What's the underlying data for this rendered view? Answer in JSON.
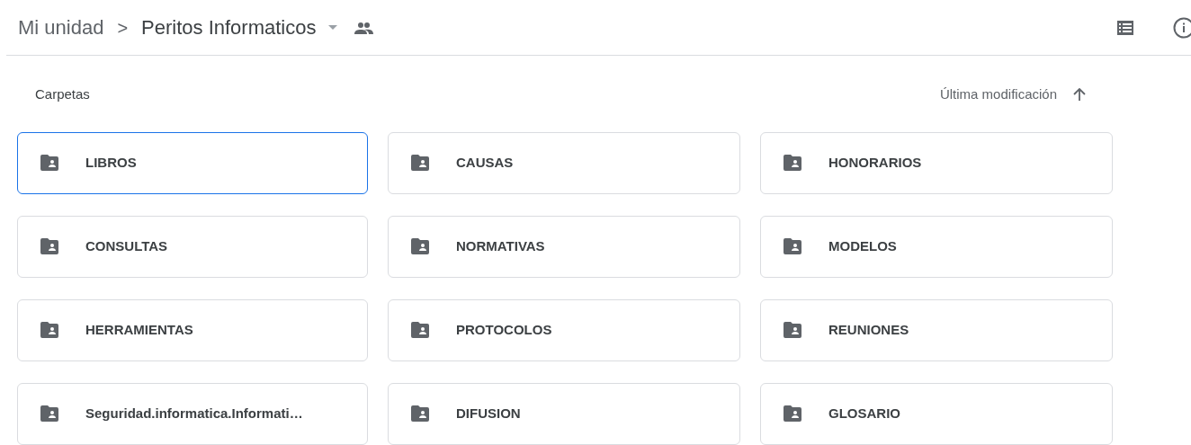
{
  "breadcrumb": {
    "root": "Mi unidad",
    "separator": ">",
    "current": "Peritos Informaticos"
  },
  "section": {
    "title": "Carpetas",
    "sort_label": "Última modificación"
  },
  "folders": [
    {
      "name": "LIBROS",
      "selected": true
    },
    {
      "name": "CAUSAS",
      "selected": false
    },
    {
      "name": "HONORARIOS",
      "selected": false
    },
    {
      "name": "CONSULTAS",
      "selected": false
    },
    {
      "name": "NORMATIVAS",
      "selected": false
    },
    {
      "name": "MODELOS",
      "selected": false
    },
    {
      "name": "HERRAMIENTAS",
      "selected": false
    },
    {
      "name": "PROTOCOLOS",
      "selected": false
    },
    {
      "name": "REUNIONES",
      "selected": false
    },
    {
      "name": "Seguridad.informatica.Informati…",
      "selected": false
    },
    {
      "name": "DIFUSION",
      "selected": false
    },
    {
      "name": "GLOSARIO",
      "selected": false
    }
  ]
}
